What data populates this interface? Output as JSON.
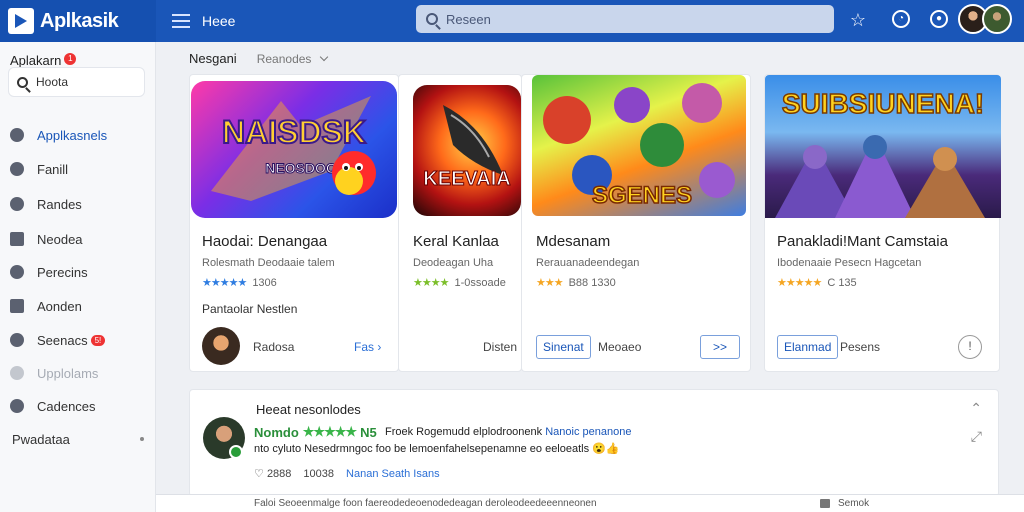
{
  "app": {
    "logo_text": "Aplkasik",
    "topbar_title": "Heee"
  },
  "search": {
    "placeholder": "Reseen"
  },
  "sidebar": {
    "header": "Aplakarn",
    "header_badge": "1",
    "search_label": "Hoota",
    "items": [
      {
        "label": "Applkasnels",
        "icon": "apps-icon"
      },
      {
        "label": "Fanill",
        "icon": "info-icon"
      },
      {
        "label": "Randes",
        "icon": "grid-icon"
      },
      {
        "label": "Neodea",
        "icon": "person-icon"
      },
      {
        "label": "Perecins",
        "icon": "key-icon"
      },
      {
        "label": "Aonden",
        "icon": "folder-icon"
      },
      {
        "label": "Seenacs",
        "icon": "rating-icon",
        "badge": "5!"
      },
      {
        "label": "Upplolams",
        "icon": "upload-icon"
      },
      {
        "label": "Cadences",
        "icon": "settings-icon"
      },
      {
        "label": "Pwadataa"
      }
    ]
  },
  "filters": {
    "main": "Nesgani",
    "sub": "Reanodes"
  },
  "cards": [
    {
      "title": "Haodai: Denangaa",
      "subtitle": "Rolesmath Deodaaie talem",
      "rating_meta": "1306",
      "line": "Pantaolar Nestlen",
      "footer": "Radosa",
      "action": "Fas",
      "img_text_1": "NAISDSK",
      "img_text_2": "NEOSDOO"
    },
    {
      "title": "Keral Kanlaa",
      "subtitle": "Deodeagan Uha",
      "rating_meta": "1-0ssoade",
      "footer": "Disten",
      "img_text": "KEEVAIA"
    },
    {
      "title": "Mdesanam",
      "subtitle": "Rerauanadeendegan",
      "rating_meta": "B88 1330",
      "button": "Sinenat",
      "footer": "Meoaeo",
      "action": ">>",
      "img_text": "SGENES"
    },
    {
      "title": "Panakladi!Mant Camstaia",
      "subtitle": "Ibodenaaie Pesecn Hagcetan",
      "rating_meta": "C 135",
      "button": "Elanmad",
      "footer": "Pesens",
      "img_text": "SUIBSIUNENA!"
    }
  ],
  "review": {
    "title": "Heeat nesonlodes",
    "name": "Nomdo",
    "tag": "N5",
    "text1_pre": "Froek Rogemudd elplodroonenk ",
    "text1_link": "Nanoic penanone",
    "text2": "nto cyluto Nesedrmngoc foo be lemoenfahelsepenamne eo eeloeatls",
    "meta_a": "2888",
    "meta_b": "10038",
    "meta_link": "Nanan Seath Isans"
  },
  "bottom": {
    "text": "Faloi Seoeenmalge foon faereodedeoenodedeagan deroleodeedeeenneonen",
    "right_label": "Semok"
  },
  "colors": {
    "brand": "#1a56b8",
    "accent": "#e33333",
    "star": "#f5a623",
    "review_green": "#2a8f3a"
  }
}
